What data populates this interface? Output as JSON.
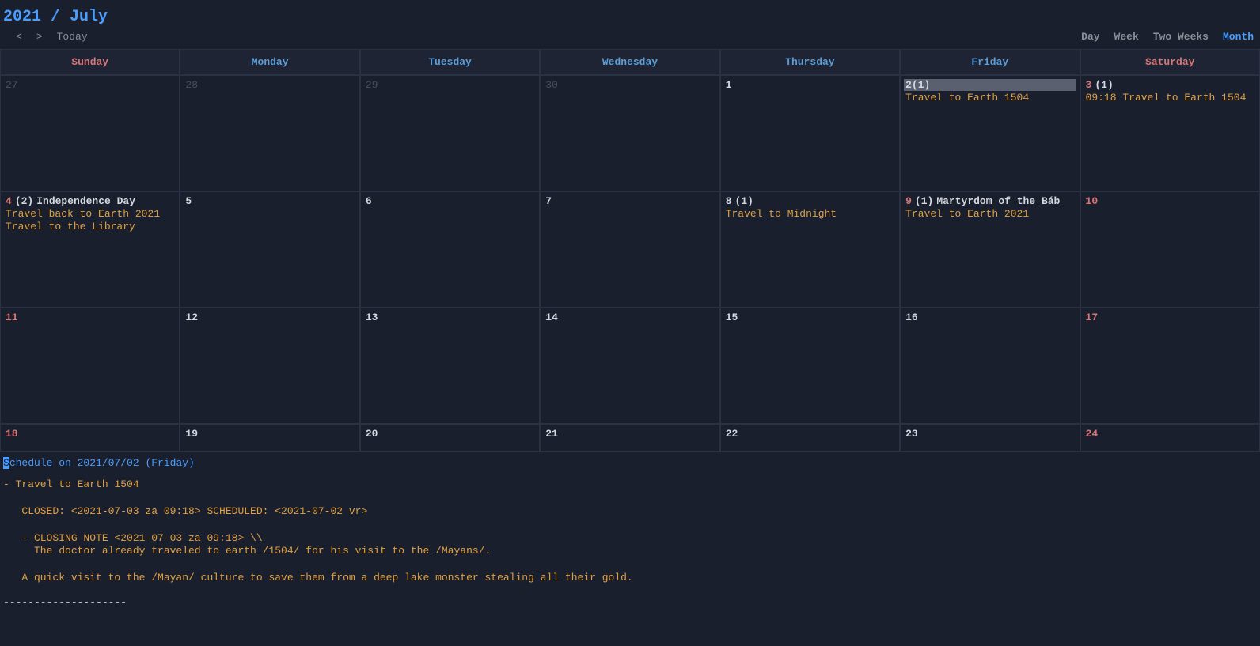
{
  "title": "2021 / July",
  "nav": {
    "prev": "<",
    "next": ">",
    "today": "Today"
  },
  "views": {
    "day": "Day",
    "week": "Week",
    "two_weeks": "Two Weeks",
    "month": "Month",
    "active": "month"
  },
  "weekdays": [
    {
      "label": "Sunday",
      "weekend": true
    },
    {
      "label": "Monday",
      "weekend": false
    },
    {
      "label": "Tuesday",
      "weekend": false
    },
    {
      "label": "Wednesday",
      "weekend": false
    },
    {
      "label": "Thursday",
      "weekend": false
    },
    {
      "label": "Friday",
      "weekend": false
    },
    {
      "label": "Saturday",
      "weekend": true
    }
  ],
  "weeks": [
    [
      {
        "day": "27",
        "muted": true,
        "weekend": true
      },
      {
        "day": "28",
        "muted": true
      },
      {
        "day": "29",
        "muted": true
      },
      {
        "day": "30",
        "muted": true
      },
      {
        "day": "1"
      },
      {
        "day": "2",
        "count": "(1)",
        "selected": true,
        "events": [
          "Travel to Earth 1504"
        ]
      },
      {
        "day": "3",
        "count": "(1)",
        "weekend": true,
        "events": [
          "09:18 Travel to Earth 1504"
        ]
      }
    ],
    [
      {
        "day": "4",
        "count": "(2)",
        "weekend": true,
        "holiday": "Independence Day",
        "events": [
          "Travel back to Earth 2021",
          "Travel to the Library"
        ]
      },
      {
        "day": "5"
      },
      {
        "day": "6"
      },
      {
        "day": "7"
      },
      {
        "day": "8",
        "count": "(1)",
        "events": [
          "Travel to Midnight"
        ]
      },
      {
        "day": "9",
        "count": "(1)",
        "weekend": true,
        "holiday": "Martyrdom of the Báb",
        "events": [
          "Travel to Earth 2021"
        ]
      },
      {
        "day": "10",
        "weekend": true
      }
    ],
    [
      {
        "day": "11",
        "weekend": true
      },
      {
        "day": "12"
      },
      {
        "day": "13"
      },
      {
        "day": "14"
      },
      {
        "day": "15"
      },
      {
        "day": "16"
      },
      {
        "day": "17",
        "weekend": true
      }
    ],
    [
      {
        "day": "18",
        "weekend": true
      },
      {
        "day": "19"
      },
      {
        "day": "20"
      },
      {
        "day": "21"
      },
      {
        "day": "22"
      },
      {
        "day": "23"
      },
      {
        "day": "24",
        "weekend": true
      }
    ]
  ],
  "last_row_short": true,
  "detail": {
    "header_first": "S",
    "header_rest": "chedule on 2021/07/02 (Friday)",
    "body": "- Travel to Earth 1504\n\n   CLOSED: <2021-07-03 za 09:18> SCHEDULED: <2021-07-02 vr>\n\n   - CLOSING NOTE <2021-07-03 za 09:18> \\\\\n     The doctor already traveled to earth /1504/ for his visit to the /Mayans/.\n\n   A quick visit to the /Mayan/ culture to save them from a deep lake monster stealing all their gold.",
    "separator": "--------------------"
  }
}
